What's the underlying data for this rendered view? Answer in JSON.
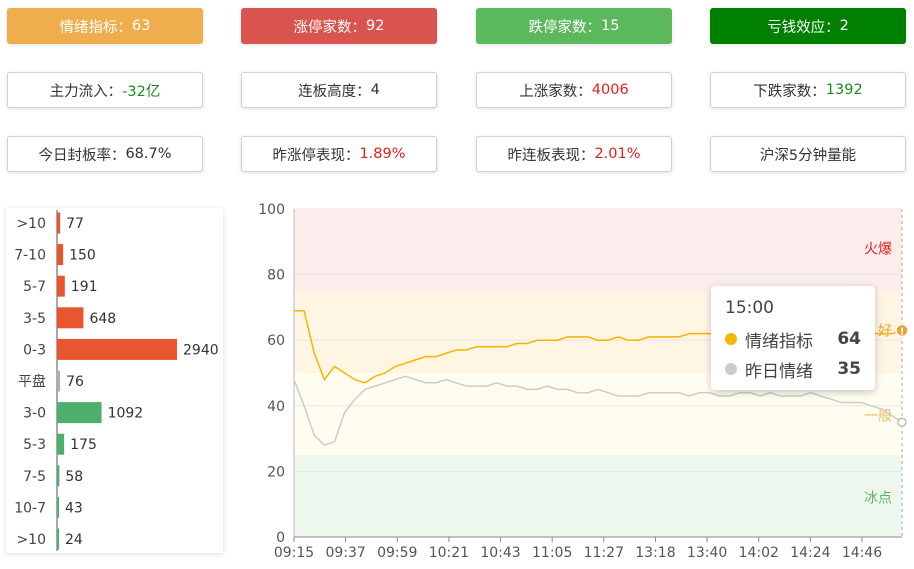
{
  "cards": {
    "sentiment": {
      "label": "情绪指标：",
      "value": "63",
      "bg": "#f0ad4e"
    },
    "limit_up": {
      "label": "涨停家数：",
      "value": "92",
      "bg": "#d9534f"
    },
    "limit_down": {
      "label": "跌停家数：",
      "value": "15",
      "bg": "#5cb85c"
    },
    "loss_effect": {
      "label": "亏钱效应：",
      "value": "2",
      "bg": "#008000"
    },
    "main_inflow": {
      "label": "主力流入：",
      "value": "-32亿"
    },
    "board_height": {
      "label": "连板高度：",
      "value": "4"
    },
    "rise_count": {
      "label": "上涨家数：",
      "value": "4006"
    },
    "fall_count": {
      "label": "下跌家数：",
      "value": "1392"
    },
    "seal_rate": {
      "label": "今日封板率：",
      "value": "68.7%"
    },
    "yday_limit_up": {
      "label": "昨涨停表现：",
      "value": "1.89%"
    },
    "yday_consec": {
      "label": "昨连板表现：",
      "value": "2.01%"
    },
    "volume_5min": {
      "label": "沪深5分钟量能"
    }
  },
  "distribution": {
    "categories": [
      ">10",
      "7-10",
      "5-7",
      "3-5",
      "0-3",
      "平盘",
      "3-0",
      "5-3",
      "7-5",
      "10-7",
      ">10"
    ],
    "values": [
      77,
      150,
      191,
      648,
      2940,
      76,
      1092,
      175,
      58,
      43,
      24
    ],
    "colors": [
      "#e8552e",
      "#e8552e",
      "#e8552e",
      "#e8552e",
      "#e8552e",
      "#a9b1bc",
      "#4caf6b",
      "#4caf6b",
      "#4caf6b",
      "#4caf6b",
      "#4caf6b"
    ]
  },
  "chart_data": {
    "type": "line",
    "x_ticks": [
      "09:15",
      "09:37",
      "09:59",
      "10:21",
      "10:43",
      "11:05",
      "11:27",
      "13:18",
      "13:40",
      "14:02",
      "14:24",
      "14:46"
    ],
    "y_ticks": [
      "0",
      "20",
      "40",
      "60",
      "80",
      "100"
    ],
    "ylim": [
      0,
      100
    ],
    "zones": [
      {
        "label": "火爆",
        "from": 75,
        "to": 100,
        "color": "#fdecec",
        "text_color": "#e02020"
      },
      {
        "label": "好",
        "from": 50,
        "to": 75,
        "color": "#fff5e3",
        "text_color": "#f0a030"
      },
      {
        "label": "一般",
        "from": 25,
        "to": 50,
        "color": "#fffdef",
        "text_color": "#e8c060"
      },
      {
        "label": "冰点",
        "from": 0,
        "to": 25,
        "color": "#eef7ee",
        "text_color": "#5cb85c"
      }
    ],
    "series": [
      {
        "name": "情绪指标",
        "color": "#f7b500",
        "values": [
          69,
          69,
          56,
          48,
          52,
          50,
          48,
          47,
          49,
          50,
          52,
          53,
          54,
          55,
          55,
          56,
          57,
          57,
          58,
          58,
          58,
          58,
          59,
          59,
          60,
          60,
          60,
          61,
          61,
          61,
          60,
          60,
          61,
          60,
          60,
          61,
          61,
          61,
          61,
          62,
          62,
          62,
          61,
          62,
          62,
          61,
          62,
          61,
          60,
          61,
          61,
          62,
          61,
          61,
          62,
          61,
          62,
          62,
          62,
          62,
          63
        ]
      },
      {
        "name": "昨日情绪",
        "color": "#cccccc",
        "values": [
          48,
          40,
          31,
          28,
          29,
          38,
          42,
          45,
          46,
          47,
          48,
          49,
          48,
          47,
          47,
          48,
          47,
          46,
          46,
          46,
          47,
          46,
          46,
          45,
          45,
          46,
          45,
          45,
          44,
          44,
          45,
          44,
          43,
          43,
          43,
          44,
          44,
          44,
          44,
          43,
          44,
          44,
          43,
          43,
          44,
          44,
          43,
          44,
          43,
          43,
          43,
          44,
          43,
          42,
          41,
          41,
          41,
          40,
          39,
          37,
          35
        ]
      }
    ],
    "tooltip": {
      "time": "15:00",
      "items": [
        {
          "name": "情绪指标",
          "value": "64"
        },
        {
          "name": "昨日情绪",
          "value": "35"
        }
      ]
    }
  }
}
